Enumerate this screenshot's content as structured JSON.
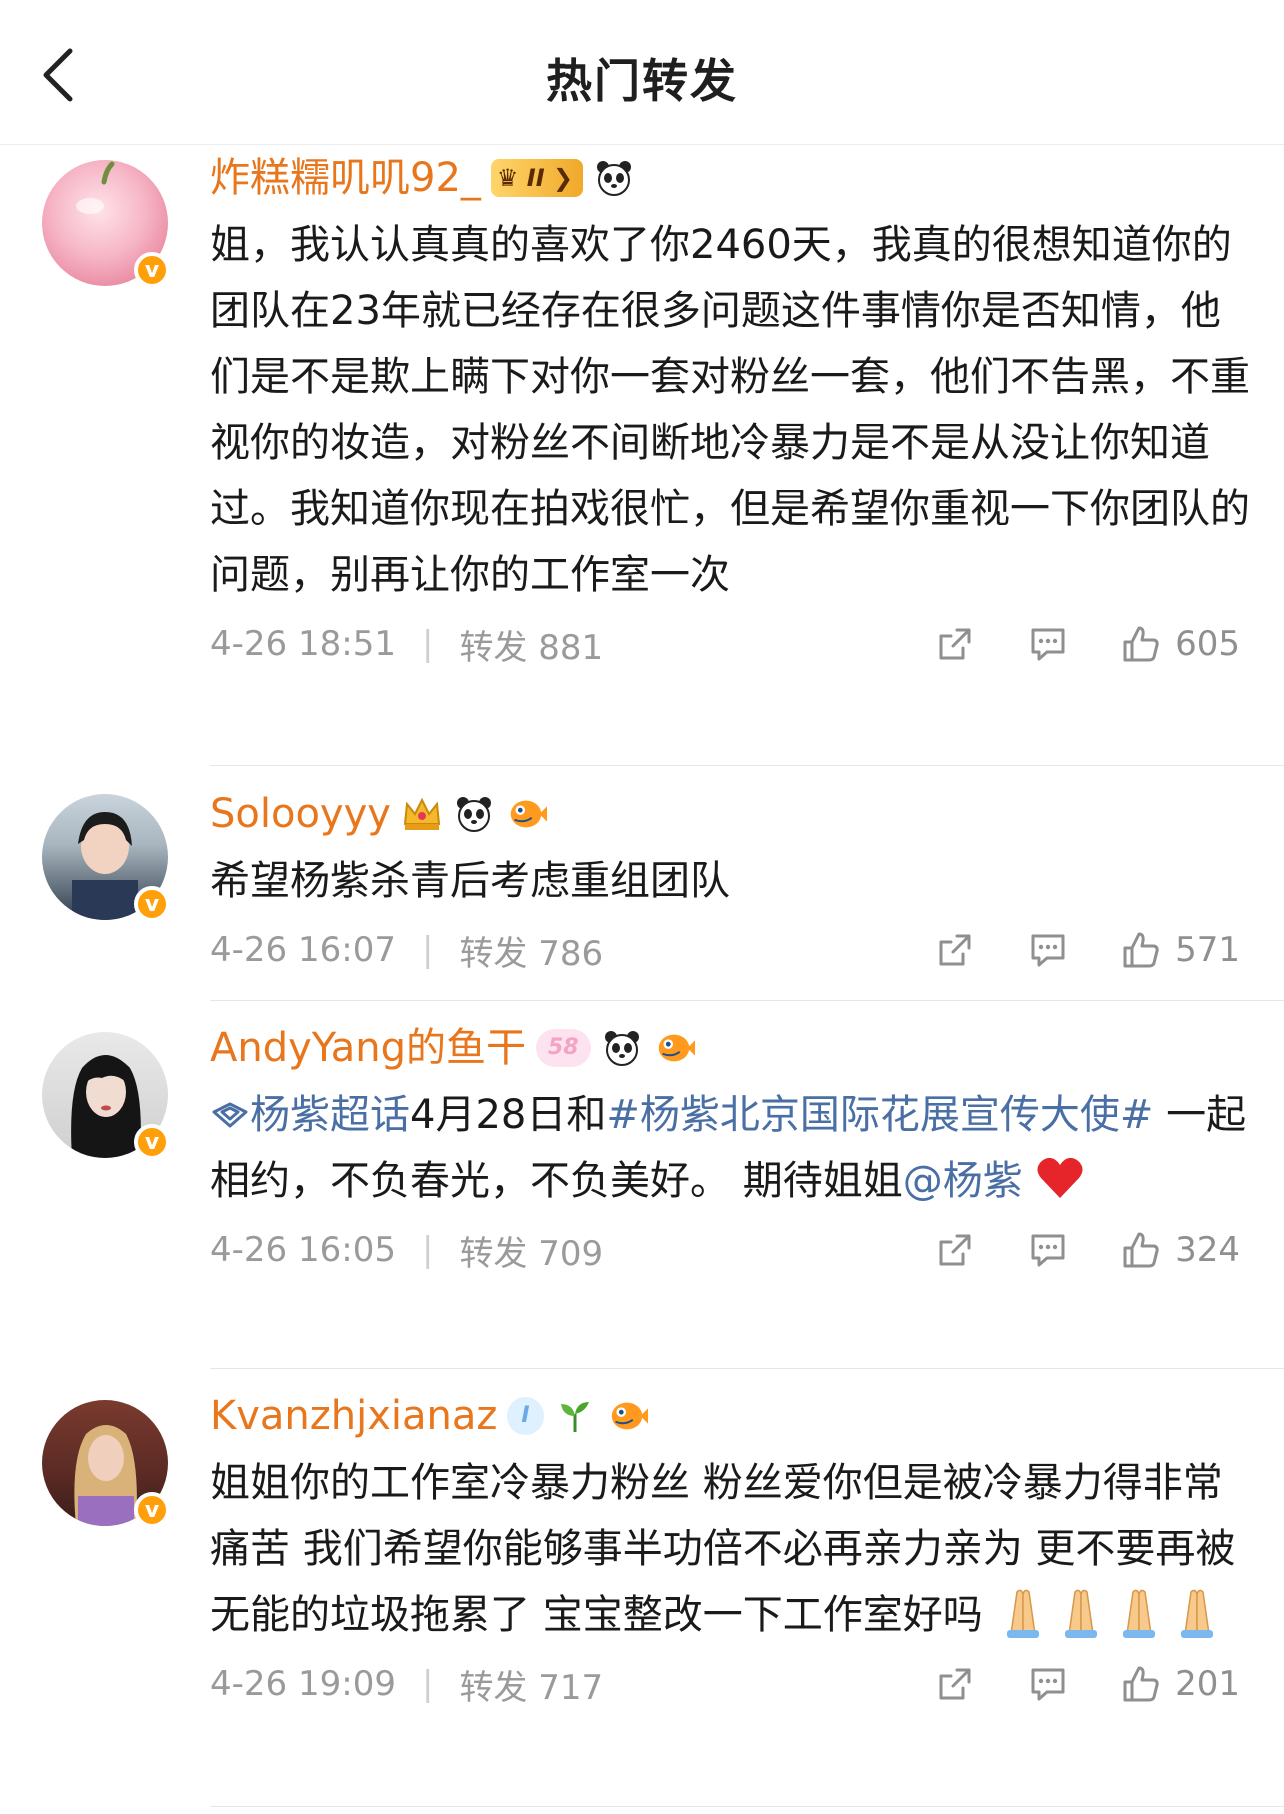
{
  "header": {
    "title": "热门转发"
  },
  "posts": [
    {
      "username": "炸糕糯叽叽92_",
      "text": "姐，我认认真真的喜欢了你2460天，我真的很想知道你的团队在23年就已经存在很多问题这件事情你是否知情，他们是不是欺上瞒下对你一套对粉丝一套，他们不告黑，不重视你的妆造，对粉丝不间断地冷暴力是不是从没让你知道过。我知道你现在拍戏很忙，但是希望你重视一下你团队的问题，别再让你的工作室一次",
      "time": "4-26 18:51",
      "repost": "转发 881",
      "likes": "605",
      "badge": "II"
    },
    {
      "username": "Solooyyy",
      "text": "希望杨紫杀青后考虑重组团队",
      "time": "4-26 16:07",
      "repost": "转发 786",
      "likes": "571"
    },
    {
      "username": "AndyYang的鱼干",
      "text_topic": "杨紫超话",
      "text_mid": "4月28日和",
      "text_hashtag": "#杨紫北京国际花展宣传大使#",
      "text_rest": "一起相约，不负春光，不负美好。 期待姐姐",
      "text_mention": "@杨紫",
      "time": "4-26 16:05",
      "repost": "转发 709",
      "likes": "324",
      "badge": "58"
    },
    {
      "username": "Kvanzhjxianaz",
      "text": "姐姐你的工作室冷暴力粉丝 粉丝爱你但是被冷暴力得非常痛苦 我们希望你能够事半功倍不必再亲力亲为 更不要再被无能的垃圾拖累了 宝宝整改一下工作室好吗",
      "time": "4-26 19:09",
      "repost": "转发 717",
      "likes": "201",
      "badge": "I"
    }
  ],
  "colors": {
    "username": "#e8761c",
    "link": "#4a6fa5",
    "meta": "#9a9a9a",
    "vbadge": "#ff9f0a"
  },
  "icons": [
    "back-icon",
    "share-icon",
    "comment-icon",
    "like-icon",
    "panda-emoji",
    "fish-emoji",
    "crown-emoji",
    "sprout-emoji",
    "heart-emoji",
    "pray-emoji"
  ]
}
